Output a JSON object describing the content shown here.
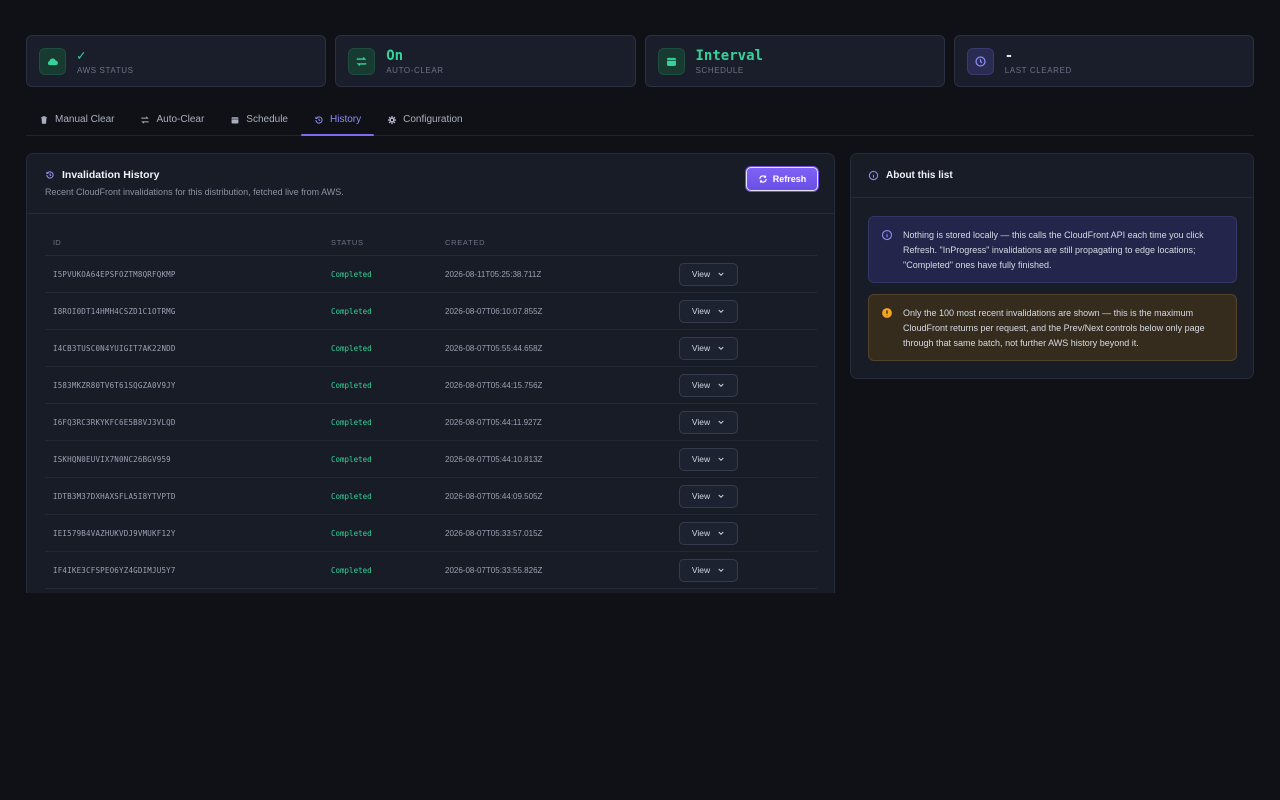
{
  "cards": [
    {
      "value": "✓",
      "label": "AWS STATUS",
      "icon": "cloud-icon",
      "tone": "green"
    },
    {
      "value": "On",
      "label": "AUTO-CLEAR",
      "icon": "repeat-icon",
      "tone": "green"
    },
    {
      "value": "Interval",
      "label": "SCHEDULE",
      "icon": "calendar-icon",
      "tone": "green"
    },
    {
      "value": "-",
      "label": "LAST CLEARED",
      "icon": "clock-icon",
      "tone": "purple"
    }
  ],
  "tabs": [
    {
      "label": "Manual Clear",
      "icon": "trash-icon"
    },
    {
      "label": "Auto-Clear",
      "icon": "repeat-icon"
    },
    {
      "label": "Schedule",
      "icon": "calendar-icon"
    },
    {
      "label": "History",
      "icon": "history-icon",
      "active": true
    },
    {
      "label": "Configuration",
      "icon": "gear-icon"
    }
  ],
  "history": {
    "title": "Invalidation History",
    "subtitle": "Recent CloudFront invalidations for this distribution, fetched live from AWS.",
    "refresh_label": "Refresh",
    "columns": {
      "id": "ID",
      "status": "STATUS",
      "created": "CREATED"
    },
    "view_label": "View",
    "rows": [
      {
        "id": "I5PVUKOA64EPSFOZTM8QRFQKMP",
        "status": "Completed",
        "created": "2026-08-11T05:25:38.711Z"
      },
      {
        "id": "I8ROI0DT14HMH4CSZD1C1OTRMG",
        "status": "Completed",
        "created": "2026-08-07T06:10:07.855Z"
      },
      {
        "id": "I4CB3TUSC0N4YUIGIT7AK22NDD",
        "status": "Completed",
        "created": "2026-08-07T05:55:44.658Z"
      },
      {
        "id": "I583MKZR80TV6T61SQGZA0V9JY",
        "status": "Completed",
        "created": "2026-08-07T05:44:15.756Z"
      },
      {
        "id": "I6FQ3RC3RKYKFC6E5B8VJ3VLQD",
        "status": "Completed",
        "created": "2026-08-07T05:44:11.927Z"
      },
      {
        "id": "ISKHQN0EUVIX7N0NC26BGV959",
        "status": "Completed",
        "created": "2026-08-07T05:44:10.813Z"
      },
      {
        "id": "IDTB3M37DXHAXSFLA5I8YTVPTD",
        "status": "Completed",
        "created": "2026-08-07T05:44:09.505Z"
      },
      {
        "id": "IEI579B4VAZHUKVDJ9VMUKF12Y",
        "status": "Completed",
        "created": "2026-08-07T05:33:57.015Z"
      },
      {
        "id": "IF4IKE3CFSPEO6YZ4GDIMJU5Y7",
        "status": "Completed",
        "created": "2026-08-07T05:33:55.826Z"
      }
    ]
  },
  "about": {
    "title": "About this list",
    "info_text": "Nothing is stored locally — this calls the CloudFront API each time you click Refresh. \"InProgress\" invalidations are still propagating to edge locations; \"Completed\" ones have fully finished.",
    "warn_text": "Only the 100 most recent invalidations are shown — this is the maximum CloudFront returns per request, and the Prev/Next controls below only page through that same batch, not further AWS history beyond it."
  },
  "colors": {
    "accent": "#7c6cf2",
    "success": "#34d399",
    "background": "#0f1117",
    "panel": "#181c26"
  }
}
